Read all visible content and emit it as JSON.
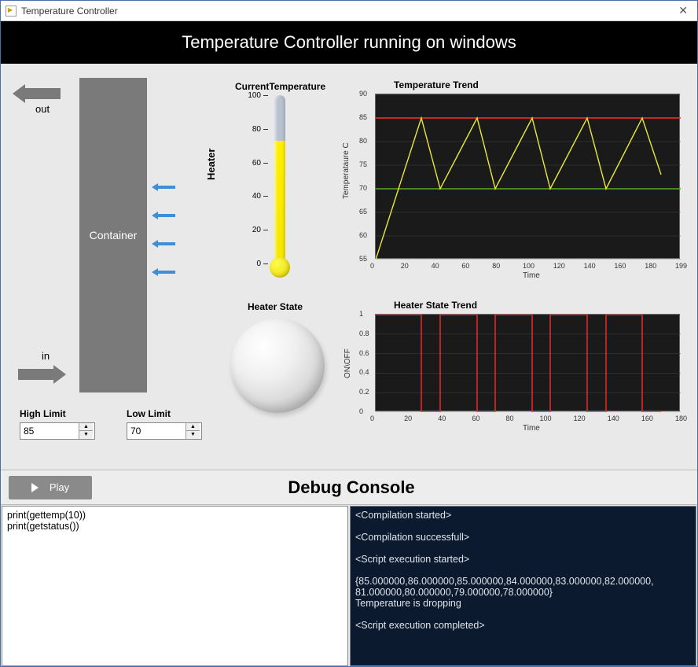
{
  "window": {
    "title": "Temperature Controller"
  },
  "banner": {
    "text": "Temperature Controller running on windows"
  },
  "diagram": {
    "out_label": "out",
    "in_label": "in",
    "container_label": "Container",
    "heater_label": "Heater"
  },
  "limits": {
    "high_label": "High Limit",
    "high_value": "85",
    "low_label": "Low Limit",
    "low_value": "70"
  },
  "thermometer": {
    "title": "CurrentTemperature",
    "ticks": [
      "100",
      "80",
      "60",
      "40",
      "20",
      "0"
    ]
  },
  "heater_state": {
    "title": "Heater State"
  },
  "temp_chart": {
    "title": "Temperature Trend",
    "ylabel": "Temperataure C",
    "xlabel": "Time",
    "yticks": [
      "90",
      "85",
      "80",
      "75",
      "70",
      "65",
      "60",
      "55"
    ],
    "xticks": [
      "0",
      "20",
      "40",
      "60",
      "80",
      "100",
      "120",
      "140",
      "160",
      "180",
      "199"
    ]
  },
  "heater_chart": {
    "title": "Heater State Trend",
    "ylabel": "ON\\OFF",
    "xlabel": "Time",
    "yticks": [
      "1",
      "0.8",
      "0.6",
      "0.4",
      "0.2",
      "0"
    ],
    "xticks": [
      "0",
      "20",
      "40",
      "60",
      "80",
      "100",
      "120",
      "140",
      "160",
      "180"
    ]
  },
  "chart_data": [
    {
      "type": "line",
      "title": "Temperature Trend",
      "xlabel": "Time",
      "ylabel": "Temperataure C",
      "xlim": [
        0,
        199
      ],
      "ylim": [
        55,
        90
      ],
      "series": [
        {
          "name": "high limit",
          "color": "#ff2a2a",
          "x": [
            0,
            199
          ],
          "y": [
            85,
            85
          ]
        },
        {
          "name": "low limit",
          "color": "#4caf1f",
          "x": [
            0,
            199
          ],
          "y": [
            70,
            70
          ]
        },
        {
          "name": "temperature",
          "color": "#e8e83e",
          "x": [
            0,
            30,
            42,
            66,
            78,
            102,
            114,
            138,
            150,
            174,
            186
          ],
          "y": [
            55,
            85,
            70,
            85,
            70,
            85,
            70,
            85,
            70,
            85,
            73
          ]
        }
      ]
    },
    {
      "type": "line",
      "title": "Heater State Trend",
      "xlabel": "Time",
      "ylabel": "ON\\OFF",
      "xlim": [
        0,
        199
      ],
      "ylim": [
        0,
        1
      ],
      "series": [
        {
          "name": "heater",
          "color": "#ff2a2a",
          "x": [
            0,
            30,
            30,
            42,
            42,
            66,
            66,
            78,
            78,
            102,
            102,
            114,
            114,
            138,
            138,
            150,
            150,
            174,
            174,
            186
          ],
          "y": [
            1,
            1,
            0,
            0,
            1,
            1,
            0,
            0,
            1,
            1,
            0,
            0,
            1,
            1,
            0,
            0,
            1,
            1,
            0,
            0
          ]
        }
      ]
    }
  ],
  "debug": {
    "play_label": "Play",
    "title": "Debug Console",
    "input_lines": [
      "print(gettemp(10))",
      "print(getstatus())"
    ],
    "output_lines": [
      "<Compilation started>",
      "<Compilation successfull>",
      "<Script execution started>",
      "{85.000000,86.000000,85.000000,84.000000,83.000000,82.000000,\n81.000000,80.000000,79.000000,78.000000}\nTemperature is dropping",
      "<Script execution completed>"
    ]
  }
}
